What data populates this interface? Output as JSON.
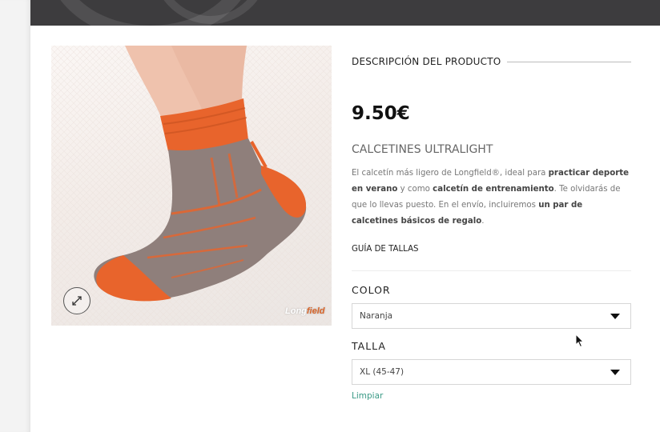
{
  "colors": {
    "banner": "#3d3c3e",
    "link": "#3a9a86",
    "sock_orange": "#e8642c",
    "sock_grey": "#8f7f7b"
  },
  "product": {
    "image": {
      "alt_icon": "zoom-expand-icon",
      "watermark_prefix": "Long",
      "watermark_suffix": "field"
    },
    "section_title": "DESCRIPCIÓN DEL PRODUCTO",
    "price": "9.50€",
    "name": "CALCETINES ULTRALIGHT",
    "description": {
      "p1": "El calcetín más ligero de Longfield®, ideal para ",
      "b1": "practicar deporte en verano",
      "p2": " y como ",
      "b2": "calcetín de entrenamiento",
      "p3": ". Te olvidarás de que lo llevas puesto. En el envío, incluiremos ",
      "b3": "un par de calcetines básicos de regalo",
      "p4": "."
    },
    "size_guide": "GUÍA DE TALLAS"
  },
  "options": {
    "color": {
      "label": "COLOR",
      "selected": "Naranja"
    },
    "size": {
      "label": "TALLA",
      "selected": "XL (45-47)"
    },
    "clear": "Limpiar"
  }
}
